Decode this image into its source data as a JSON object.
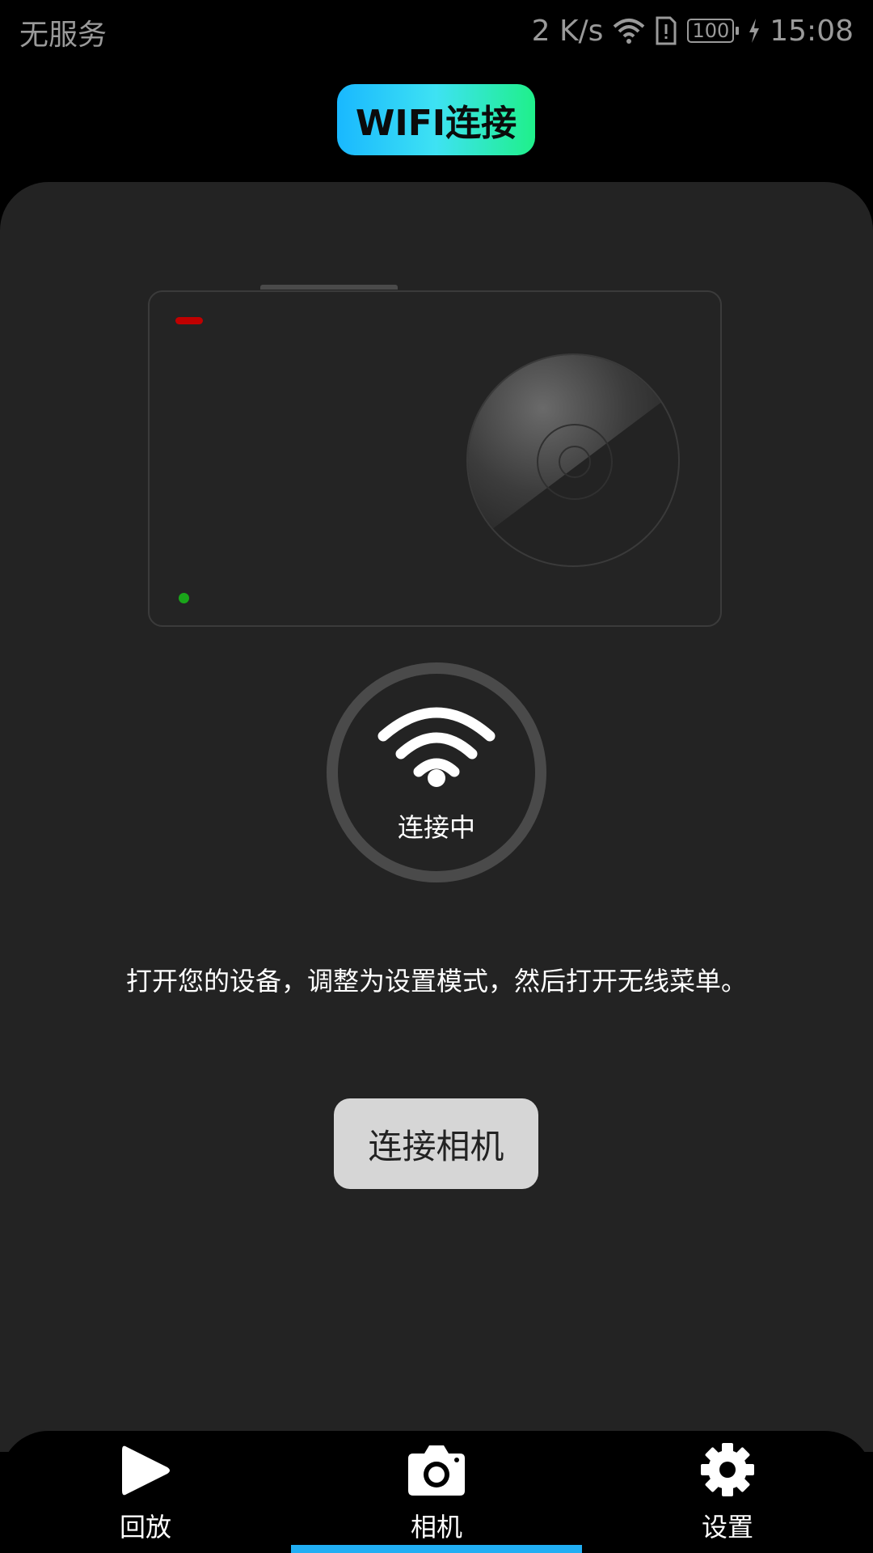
{
  "status_bar": {
    "carrier": "无服务",
    "net_speed": "2 K/s",
    "battery": "100",
    "time": "15:08"
  },
  "header": {
    "title": "WIFI连接"
  },
  "camera_illustration": {
    "rec_led_color": "#c00000",
    "status_led_color": "#1aa51a"
  },
  "wifi_status": {
    "label": "连接中"
  },
  "instruction": "打开您的设备，调整为设置模式，然后打开无线菜单。",
  "connect_button": {
    "label": "连接相机"
  },
  "bottom_nav": {
    "items": [
      {
        "label": "回放",
        "icon": "play-icon"
      },
      {
        "label": "相机",
        "icon": "camera-icon",
        "active": true
      },
      {
        "label": "设置",
        "icon": "gear-icon"
      }
    ],
    "active_color": "#21aef4"
  }
}
